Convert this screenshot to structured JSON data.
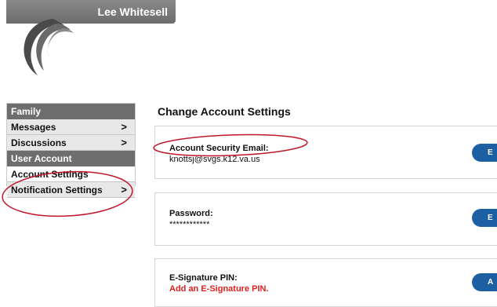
{
  "header": {
    "user_name": "Lee Whitesell"
  },
  "sidebar": {
    "sections": [
      {
        "type": "header",
        "label": "Family"
      },
      {
        "type": "item",
        "label": "Messages",
        "arrow": ">"
      },
      {
        "type": "item",
        "label": "Discussions",
        "arrow": ">"
      },
      {
        "type": "header",
        "label": "User Account"
      },
      {
        "type": "item",
        "label": "Account Settings",
        "active": true
      },
      {
        "type": "item",
        "label": "Notification Settings",
        "arrow": ">"
      }
    ]
  },
  "main": {
    "title": "Change Account Settings",
    "cards": [
      {
        "label": "Account Security Email:",
        "value": "knottsj@svgs.k12.va.us",
        "button": "E"
      },
      {
        "label": "Password:",
        "value": "************",
        "button": "E"
      },
      {
        "label": "E-Signature PIN:",
        "value": "Add an E-Signature PIN.",
        "button": "A"
      }
    ]
  },
  "colors": {
    "accent_button": "#1d5fa3",
    "nav_header": "#6e6e6e",
    "warning_text": "#e02020",
    "annotation": "#c0182a"
  }
}
